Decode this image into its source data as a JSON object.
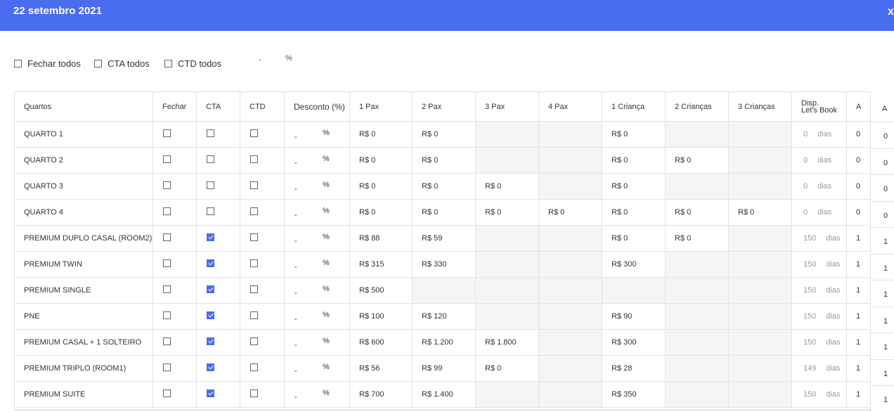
{
  "header": {
    "title": "22 setembro 2021",
    "close": "x"
  },
  "bulk": {
    "fechar_label": "Fechar todos",
    "cta_label": "CTA todos",
    "ctd_label": "CTD todos",
    "discount_value": "-",
    "discount_unit": "%"
  },
  "table": {
    "headers": [
      "Quartos",
      "Fechar",
      "CTA",
      "CTD",
      "Desconto (%)",
      "1 Pax",
      "2 Pax",
      "3 Pax",
      "4 Pax",
      "1 Criança",
      "2 Crianças",
      "3 Crianças",
      "Disp. Let's Book",
      "A"
    ],
    "disp_header_line1": "Disp.",
    "disp_header_line2": "Let's Book",
    "dias_label": "dias",
    "discount_value": "-",
    "discount_unit": "%",
    "rows": [
      {
        "name": "QUARTO 1",
        "fechar": false,
        "cta": false,
        "ctd": false,
        "p1": "R$ 0",
        "p2": "R$ 0",
        "p3": "",
        "p4": "",
        "c1": "R$ 0",
        "c2": "",
        "c3": "",
        "disp": "0",
        "a": "0",
        "a2": "0"
      },
      {
        "name": "QUARTO 2",
        "fechar": false,
        "cta": false,
        "ctd": false,
        "p1": "R$ 0",
        "p2": "R$ 0",
        "p3": "",
        "p4": "",
        "c1": "R$ 0",
        "c2": "R$ 0",
        "c3": "",
        "disp": "0",
        "a": "0",
        "a2": "0"
      },
      {
        "name": "QUARTO 3",
        "fechar": false,
        "cta": false,
        "ctd": false,
        "p1": "R$ 0",
        "p2": "R$ 0",
        "p3": "R$ 0",
        "p4": "",
        "c1": "R$ 0",
        "c2": "",
        "c3": "",
        "disp": "0",
        "a": "0",
        "a2": "0"
      },
      {
        "name": "QUARTO 4",
        "fechar": false,
        "cta": false,
        "ctd": false,
        "p1": "R$ 0",
        "p2": "R$ 0",
        "p3": "R$ 0",
        "p4": "R$ 0",
        "c1": "R$ 0",
        "c2": "R$ 0",
        "c3": "R$ 0",
        "disp": "0",
        "a": "0",
        "a2": "0"
      },
      {
        "name": "PREMIUM DUPLO CASAL (ROOM2)",
        "fechar": false,
        "cta": true,
        "ctd": false,
        "p1": "R$ 88",
        "p2": "R$ 59",
        "p3": "",
        "p4": "",
        "c1": "R$ 0",
        "c2": "R$ 0",
        "c3": "",
        "disp": "150",
        "a": "1",
        "a2": "1"
      },
      {
        "name": "PREMIUM TWIN",
        "fechar": false,
        "cta": true,
        "ctd": false,
        "p1": "R$ 315",
        "p2": "R$ 330",
        "p3": "",
        "p4": "",
        "c1": "R$ 300",
        "c2": "",
        "c3": "",
        "disp": "150",
        "a": "1",
        "a2": "1"
      },
      {
        "name": "PREMIUM SINGLE",
        "fechar": false,
        "cta": true,
        "ctd": false,
        "p1": "R$ 500",
        "p2": "",
        "p3": "",
        "p4": "",
        "c1": "",
        "c2": "",
        "c3": "",
        "disp": "150",
        "a": "1",
        "a2": "1"
      },
      {
        "name": "PNE",
        "fechar": false,
        "cta": true,
        "ctd": false,
        "p1": "R$ 100",
        "p2": "R$ 120",
        "p3": "",
        "p4": "",
        "c1": "R$ 90",
        "c2": "",
        "c3": "",
        "disp": "150",
        "a": "1",
        "a2": "1"
      },
      {
        "name": "PREMIUM CASAL + 1 SOLTEIRO",
        "fechar": false,
        "cta": true,
        "ctd": false,
        "p1": "R$ 600",
        "p2": "R$ 1.200",
        "p3": "R$ 1.800",
        "p4": "",
        "c1": "R$ 300",
        "c2": "",
        "c3": "",
        "disp": "150",
        "a": "1",
        "a2": "1"
      },
      {
        "name": "PREMIUM TRIPLO (ROOM1)",
        "fechar": false,
        "cta": true,
        "ctd": false,
        "p1": "R$ 56",
        "p2": "R$ 99",
        "p3": "R$ 0",
        "p4": "",
        "c1": "R$ 28",
        "c2": "",
        "c3": "",
        "disp": "149",
        "a": "1",
        "a2": "1"
      },
      {
        "name": "PREMIUM SUITE",
        "fechar": false,
        "cta": true,
        "ctd": false,
        "p1": "R$ 700",
        "p2": "R$ 1.400",
        "p3": "",
        "p4": "",
        "c1": "R$ 350",
        "c2": "",
        "c3": "",
        "disp": "150",
        "a": "1",
        "a2": "1"
      }
    ]
  },
  "colors": {
    "header_bg": "#4a6cf0",
    "checkbox_checked": "#4a6cf0",
    "empty_cell": "#f5f5f5"
  }
}
